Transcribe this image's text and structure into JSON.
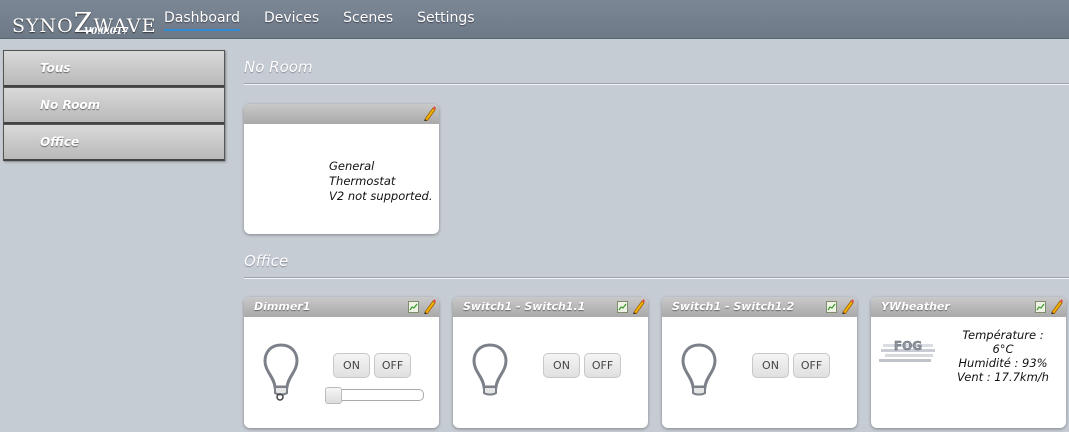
{
  "app": {
    "brand": "SYNOZWAVE",
    "version": "V0.0.017"
  },
  "nav": [
    {
      "label": "Dashboard",
      "active": true
    },
    {
      "label": "Devices",
      "active": false
    },
    {
      "label": "Scenes",
      "active": false
    },
    {
      "label": "Settings",
      "active": false
    }
  ],
  "sidebar": {
    "items": [
      {
        "label": "Tous"
      },
      {
        "label": "No Room"
      },
      {
        "label": "Office"
      }
    ]
  },
  "sections": {
    "no_room": {
      "title": "No Room",
      "thermostat_line1": "General Thermostat",
      "thermostat_line2": "V2 not supported."
    },
    "office": {
      "title": "Office",
      "devices": [
        {
          "title": "Dimmer1",
          "on_label": "ON",
          "off_label": "OFF",
          "level": 0
        },
        {
          "title": "Switch1 - Switch1.1",
          "on_label": "ON",
          "off_label": "OFF"
        },
        {
          "title": "Switch1 - Switch1.2",
          "on_label": "ON",
          "off_label": "OFF"
        },
        {
          "title": "YWheather",
          "icon_label": "FOG",
          "temperature": "Température : 6°C",
          "humidity": "Humidité : 93%",
          "wind": "Vent : 17.7km/h"
        }
      ]
    }
  },
  "colors": {
    "background": "#c6ccd3",
    "topbar": "#6d7987",
    "nav_active_underline": "#2d8cd4"
  }
}
